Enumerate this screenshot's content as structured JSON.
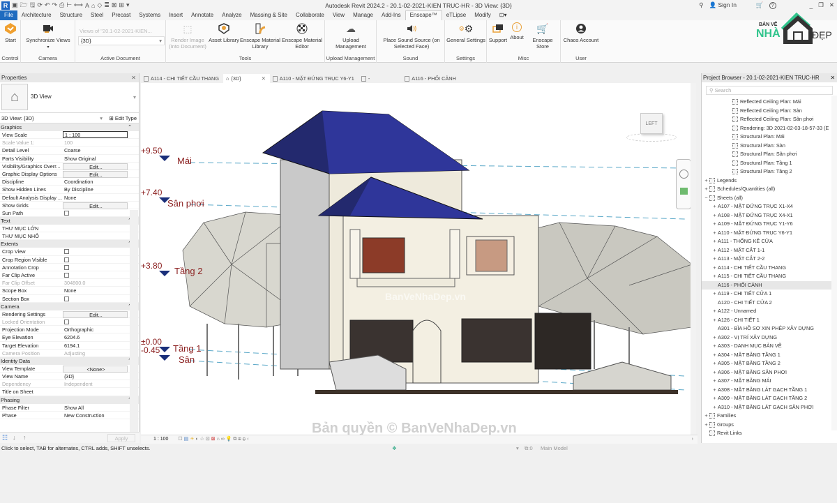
{
  "titlebar": {
    "title": "Autodesk Revit 2024.2 - 20.1-02-2021-KIEN TRUC-HR - 3D View: {3D}",
    "sign_in": "Sign In",
    "help": "?",
    "minimize": "_",
    "restore": "❐",
    "close": "✕"
  },
  "ribbon_tabs": [
    "File",
    "Architecture",
    "Structure",
    "Steel",
    "Precast",
    "Systems",
    "Insert",
    "Annotate",
    "Analyze",
    "Massing & Site",
    "Collaborate",
    "View",
    "Manage",
    "Add-Ins",
    "Enscape™",
    "eTLipse",
    "Modify"
  ],
  "active_tab": "Enscape™",
  "ribbon": {
    "groups": [
      {
        "label": "Control",
        "buttons": [
          {
            "label": "Start",
            "icon": "enscape-start-icon"
          }
        ]
      },
      {
        "label": "Camera",
        "buttons": [
          {
            "label": "Synchronize Views",
            "icon": "video-camera-icon"
          }
        ]
      },
      {
        "label": "Active Document",
        "views_label": "Views of \"20.1-02-2021-KIEN...",
        "views_value": "{3D}"
      },
      {
        "label": "Tools",
        "buttons": [
          {
            "label": "Render Image (Into Document)",
            "icon": "render-image-icon",
            "disabled": true
          },
          {
            "label": "Asset Library",
            "icon": "asset-library-icon"
          },
          {
            "label": "Enscape Material Library",
            "icon": "material-library-icon"
          },
          {
            "label": "Enscape Material Editor",
            "icon": "material-editor-icon"
          }
        ]
      },
      {
        "label": "Upload Management",
        "buttons": [
          {
            "label": "Upload Management",
            "icon": "cloud-upload-icon"
          }
        ]
      },
      {
        "label": "Sound",
        "buttons": [
          {
            "label": "Place Sound Source (on Selected Face)",
            "icon": "speaker-icon"
          }
        ]
      },
      {
        "label": "Settings",
        "buttons": [
          {
            "label": "General Settings",
            "icon": "gears-icon"
          }
        ]
      },
      {
        "label": "Misc",
        "buttons": [
          {
            "label": "Support",
            "icon": "chat-icon"
          },
          {
            "label": "About",
            "icon": "info-icon"
          },
          {
            "label": "Enscape Store",
            "icon": "cart-icon"
          }
        ]
      },
      {
        "label": "User",
        "buttons": [
          {
            "label": "Chaos Account",
            "icon": "user-icon"
          }
        ]
      }
    ]
  },
  "properties": {
    "title": "Properties",
    "type_name": "3D View",
    "instance": "3D View: {3D}",
    "edit_type": "Edit Type",
    "sections": [
      {
        "name": "Graphics",
        "rows": [
          {
            "k": "View Scale",
            "v": "1 : 100",
            "kind": "box"
          },
          {
            "k": "Scale Value    1:",
            "v": "100",
            "dim": true
          },
          {
            "k": "Detail Level",
            "v": "Coarse"
          },
          {
            "k": "Parts Visibility",
            "v": "Show Original"
          },
          {
            "k": "Visibility/Graphics Overr...",
            "v": "Edit...",
            "kind": "btn"
          },
          {
            "k": "Graphic Display Options",
            "v": "Edit...",
            "kind": "btn"
          },
          {
            "k": "Discipline",
            "v": "Coordination"
          },
          {
            "k": "Show Hidden Lines",
            "v": "By Discipline"
          },
          {
            "k": "Default Analysis Display ...",
            "v": "None"
          },
          {
            "k": "Show Grids",
            "v": "Edit...",
            "kind": "btn"
          },
          {
            "k": "Sun Path",
            "v": "",
            "kind": "cb"
          }
        ]
      },
      {
        "name": "Text",
        "rows": [
          {
            "k": "THƯ MỤC LỚN",
            "v": ""
          },
          {
            "k": "THƯ MỤC NHỎ",
            "v": ""
          }
        ]
      },
      {
        "name": "Extents",
        "rows": [
          {
            "k": "Crop View",
            "v": "",
            "kind": "cb"
          },
          {
            "k": "Crop Region Visible",
            "v": "",
            "kind": "cb"
          },
          {
            "k": "Annotation Crop",
            "v": "",
            "kind": "cb"
          },
          {
            "k": "Far Clip Active",
            "v": "",
            "kind": "cb"
          },
          {
            "k": "Far Clip Offset",
            "v": "304800.0",
            "dim": true
          },
          {
            "k": "Scope Box",
            "v": "None"
          },
          {
            "k": "Section Box",
            "v": "",
            "kind": "cb"
          }
        ]
      },
      {
        "name": "Camera",
        "rows": [
          {
            "k": "Rendering Settings",
            "v": "Edit...",
            "kind": "btn"
          },
          {
            "k": "Locked Orientation",
            "v": "",
            "kind": "cb",
            "dim": true
          },
          {
            "k": "Projection Mode",
            "v": "Orthographic"
          },
          {
            "k": "Eye Elevation",
            "v": "6204.6"
          },
          {
            "k": "Target Elevation",
            "v": "6194.1"
          },
          {
            "k": "Camera Position",
            "v": "Adjusting",
            "dim": true
          }
        ]
      },
      {
        "name": "Identity Data",
        "rows": [
          {
            "k": "View Template",
            "v": "<None>",
            "kind": "btn"
          },
          {
            "k": "View Name",
            "v": "{3D}"
          },
          {
            "k": "Dependency",
            "v": "Independent",
            "dim": true
          },
          {
            "k": "Title on Sheet",
            "v": ""
          }
        ]
      },
      {
        "name": "Phasing",
        "rows": [
          {
            "k": "Phase Filter",
            "v": "Show All"
          },
          {
            "k": "Phase",
            "v": "New Construction"
          }
        ]
      }
    ],
    "apply": "Apply"
  },
  "view_tabs": [
    {
      "label": "A114 - CHI TIẾT CẦU THANG",
      "icon": "sheet-icon"
    },
    {
      "label": "{3D}",
      "icon": "house-icon",
      "active": true
    },
    {
      "label": "A110 - MẶT ĐỨNG TRỤC Y6-Y1",
      "icon": "sheet-icon"
    },
    {
      "label": "-",
      "icon": "sheet-icon"
    },
    {
      "label": "A116 - PHỐI CẢNH",
      "icon": "sheet-icon"
    }
  ],
  "levels": [
    {
      "elev": "+9.50",
      "name": "Mái"
    },
    {
      "elev": "+7.40",
      "name": "Sân phơi"
    },
    {
      "elev": "+3.80",
      "name": "Tầng 2"
    },
    {
      "elev": "±0.00",
      "name": "Tầng 1"
    },
    {
      "elev": "-0.45",
      "name": "Sân"
    }
  ],
  "viewcube_face": "LEFT",
  "view_control_bar": {
    "scale": "1 : 100"
  },
  "watermarks": {
    "center": "BanVeNhaDep.vn",
    "bottom": "Bản quyền © BanVeNhaDep.vn"
  },
  "project_browser": {
    "title": "Project Browser - 20.1-02-2021-KIEN TRUC-HR",
    "search_placeholder": "Search",
    "views": [
      "Reflected Ceiling Plan: Mái",
      "Reflected Ceiling Plan: Sàn",
      "Reflected Ceiling Plan: Sân phơi",
      "Rendering: 3D 2021-02-03-18-57-33 (E",
      "Structural Plan: Mái",
      "Structural Plan: Sàn",
      "Structural Plan: Sân phơi",
      "Structural Plan: Tầng 1",
      "Structural Plan: Tầng 2"
    ],
    "categories": [
      {
        "label": "Legends",
        "pm": "+"
      },
      {
        "label": "Schedules/Quantities (all)",
        "pm": "+"
      },
      {
        "label": "Sheets (all)",
        "pm": "−"
      }
    ],
    "sheets": [
      {
        "label": "A107 - MẶT ĐỨNG TRỤC X1-X4",
        "pm": "+"
      },
      {
        "label": "A108 - MẶT ĐỨNG TRỤC X4-X1",
        "pm": "+"
      },
      {
        "label": "A109 - MẶT ĐỨNG TRỤC Y1-Y6",
        "pm": "+"
      },
      {
        "label": "A110 - MẶT ĐỨNG TRỤC Y6-Y1",
        "pm": "+"
      },
      {
        "label": "A111 - THỐNG KÊ CỬA",
        "pm": "+"
      },
      {
        "label": "A112 - MẶT CẮT 1-1",
        "pm": "+"
      },
      {
        "label": "A113 - MẶT CẮT 2-2",
        "pm": "+"
      },
      {
        "label": "A114 - CHI TIẾT CẦU THANG",
        "pm": "+"
      },
      {
        "label": "A115 - CHI TIẾT CẦU THANG",
        "pm": "+"
      },
      {
        "label": "A116 - PHỐI CẢNH",
        "pm": "",
        "selected": true
      },
      {
        "label": "A119 - CHI TIẾT CỬA 1",
        "pm": "+"
      },
      {
        "label": "A120 - CHI TIẾT CỬA 2",
        "pm": ""
      },
      {
        "label": "A122 - Unnamed",
        "pm": "+"
      },
      {
        "label": "A126 - CHI TIẾT 1",
        "pm": "+"
      },
      {
        "label": "A301 - BÌA HỒ SƠ XIN PHÉP XÂY DỰNG",
        "pm": ""
      },
      {
        "label": "A302 - VỊ TRÍ XÂY DỰNG",
        "pm": "+"
      },
      {
        "label": "A303 - DANH MỤC BẢN VẼ",
        "pm": "+"
      },
      {
        "label": "A304 - MẶT BẰNG TẦNG 1",
        "pm": "+"
      },
      {
        "label": "A305 - MẶT BẰNG TẦNG 2",
        "pm": "+"
      },
      {
        "label": "A306 - MẶT BẰNG SÂN PHƠI",
        "pm": "+"
      },
      {
        "label": "A307 - MẶT BẰNG MÁI",
        "pm": "+"
      },
      {
        "label": "A308 - MẶT BẰNG LÁT GẠCH TẦNG 1",
        "pm": "+"
      },
      {
        "label": "A309 - MẶT BẰNG LÁT GẠCH TẦNG 2",
        "pm": "+"
      },
      {
        "label": "A310 - MẶT BẰNG LÁT GẠCH SÂN PHƠI",
        "pm": "+"
      }
    ],
    "tail": [
      {
        "label": "Families",
        "pm": "+"
      },
      {
        "label": "Groups",
        "pm": "+"
      },
      {
        "label": "Revit Links",
        "pm": ""
      }
    ]
  },
  "status_bar": {
    "hint": "Click to select, TAB for alternates, CTRL adds, SHIFT unselects.",
    "selection_count": ":0",
    "model": "Main Model",
    "filter_count": ":0"
  },
  "brand": {
    "line1": "BẢN VẼ",
    "line2": "NHÀ",
    "line3": "ĐẸP"
  },
  "colors": {
    "roof": "#2b2f8f",
    "level_text": "#8b1f1f",
    "level_marker": "#1a2f7a",
    "file_tab": "#1f6bbf",
    "brand_green": "#2fc48c"
  }
}
